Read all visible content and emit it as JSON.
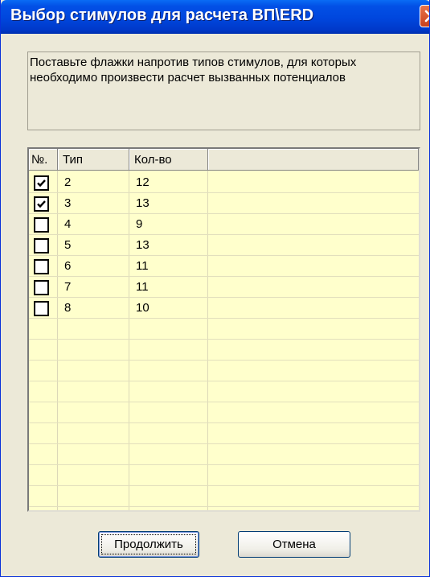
{
  "window": {
    "title": "Выбор стимулов для расчета ВП\\ERD"
  },
  "description": {
    "line1": "Поставьте флажки напротив типов стимулов, для которых",
    "line2": "необходимо произвести расчет вызванных потенциалов"
  },
  "table": {
    "columns": [
      "№.",
      "Тип",
      "Кол-во",
      ""
    ],
    "rows": [
      {
        "checked": true,
        "type": "2",
        "count": "12"
      },
      {
        "checked": true,
        "type": "3",
        "count": "13"
      },
      {
        "checked": false,
        "type": "4",
        "count": "9"
      },
      {
        "checked": false,
        "type": "5",
        "count": "13"
      },
      {
        "checked": false,
        "type": "6",
        "count": "11"
      },
      {
        "checked": false,
        "type": "7",
        "count": "11"
      },
      {
        "checked": false,
        "type": "8",
        "count": "10"
      }
    ]
  },
  "buttons": {
    "continue": "Продолжить",
    "cancel": "Отмена"
  }
}
